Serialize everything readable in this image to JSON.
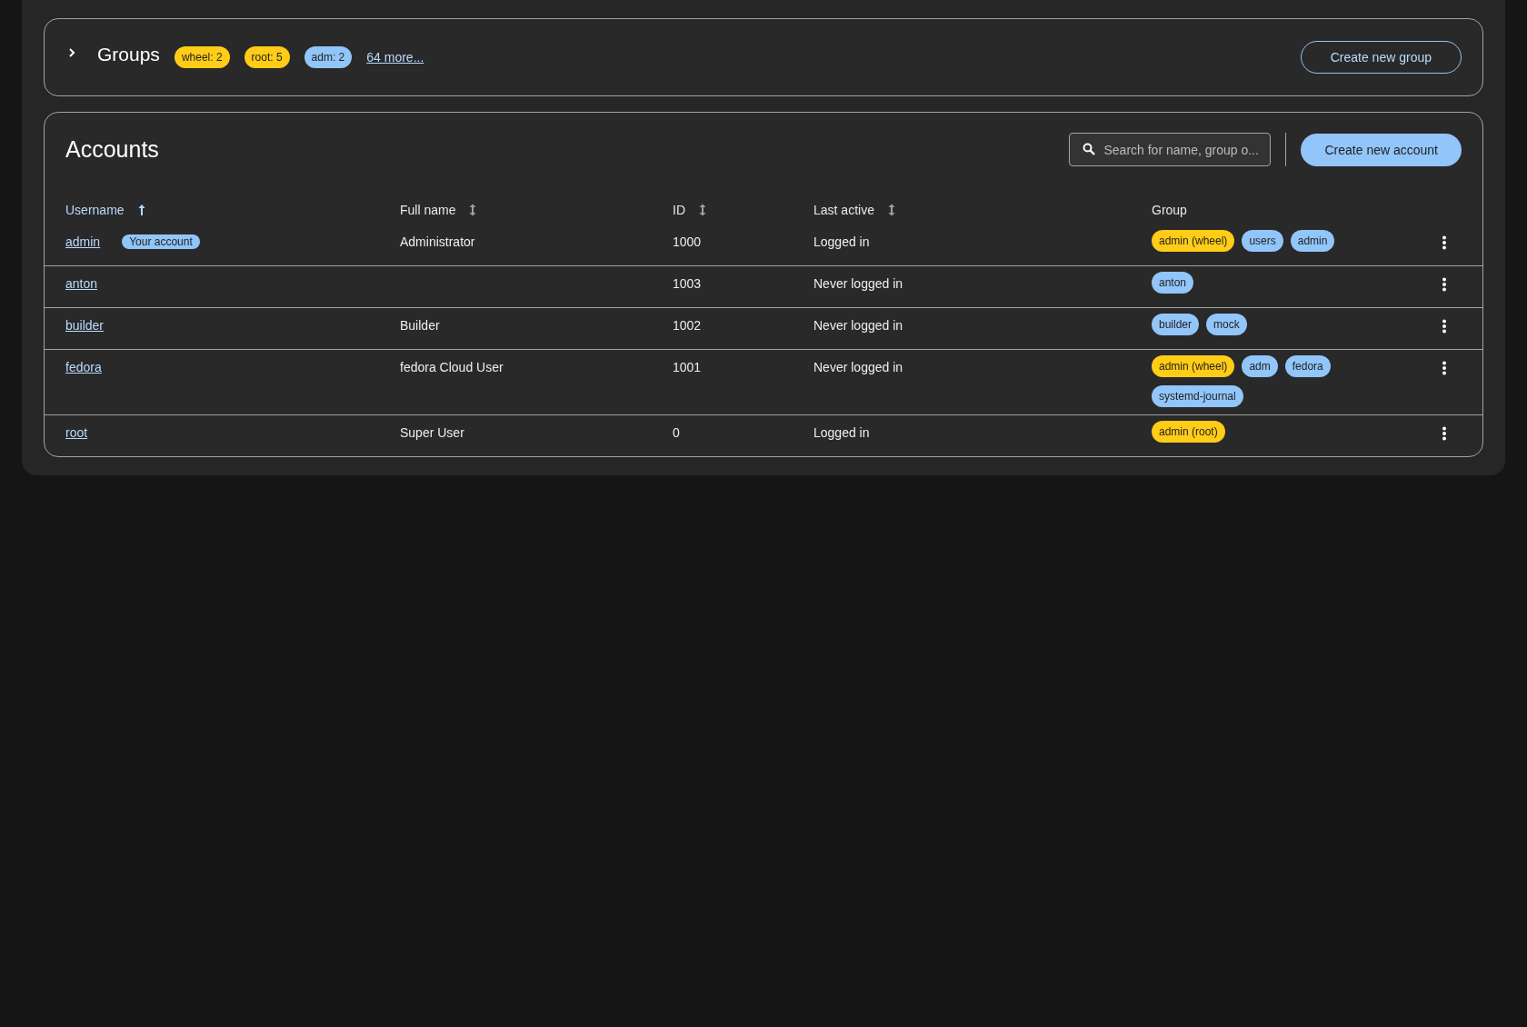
{
  "groups_card": {
    "title": "Groups",
    "expanded": false,
    "summary_tags": [
      {
        "label": "wheel: 2",
        "color": "#ffcc17"
      },
      {
        "label": "root: 5",
        "color": "#ffcc17"
      },
      {
        "label": "adm: 2",
        "color": "#92c5f9"
      }
    ],
    "more_link": "64 more...",
    "create_button": "Create new group"
  },
  "accounts_card": {
    "title": "Accounts",
    "search": {
      "placeholder": "Search for name, group o..."
    },
    "create_button": "Create new account",
    "columns": [
      {
        "label": "Username",
        "sortable": true,
        "selected": true
      },
      {
        "label": "Full name",
        "sortable": true,
        "selected": false
      },
      {
        "label": "ID",
        "sortable": true,
        "selected": false
      },
      {
        "label": "Last active",
        "sortable": true,
        "selected": false
      },
      {
        "label": "Group",
        "sortable": false,
        "selected": false
      }
    ],
    "rows": [
      {
        "username": "admin",
        "badge": "Your account",
        "full_name": "Administrator",
        "id": "1000",
        "last_active": "Logged in",
        "groups": [
          {
            "label": "admin (wheel)",
            "color": "#ffcc17"
          },
          {
            "label": "users",
            "color": "#92c5f9"
          },
          {
            "label": "admin",
            "color": "#92c5f9"
          }
        ]
      },
      {
        "username": "anton",
        "full_name": "",
        "id": "1003",
        "last_active": "Never logged in",
        "groups": [
          {
            "label": "anton",
            "color": "#92c5f9"
          }
        ]
      },
      {
        "username": "builder",
        "full_name": "Builder",
        "id": "1002",
        "last_active": "Never logged in",
        "groups": [
          {
            "label": "builder",
            "color": "#92c5f9"
          },
          {
            "label": "mock",
            "color": "#92c5f9"
          }
        ]
      },
      {
        "username": "fedora",
        "full_name": "fedora Cloud User",
        "id": "1001",
        "last_active": "Never logged in",
        "groups": [
          {
            "label": "admin (wheel)",
            "color": "#ffcc17"
          },
          {
            "label": "adm",
            "color": "#92c5f9"
          },
          {
            "label": "fedora",
            "color": "#92c5f9"
          },
          {
            "label": "systemd-journal",
            "color": "#92c5f9"
          }
        ]
      },
      {
        "username": "root",
        "full_name": "Super User",
        "id": "0",
        "last_active": "Logged in",
        "groups": [
          {
            "label": "admin (root)",
            "color": "#ffcc17"
          }
        ]
      }
    ]
  }
}
